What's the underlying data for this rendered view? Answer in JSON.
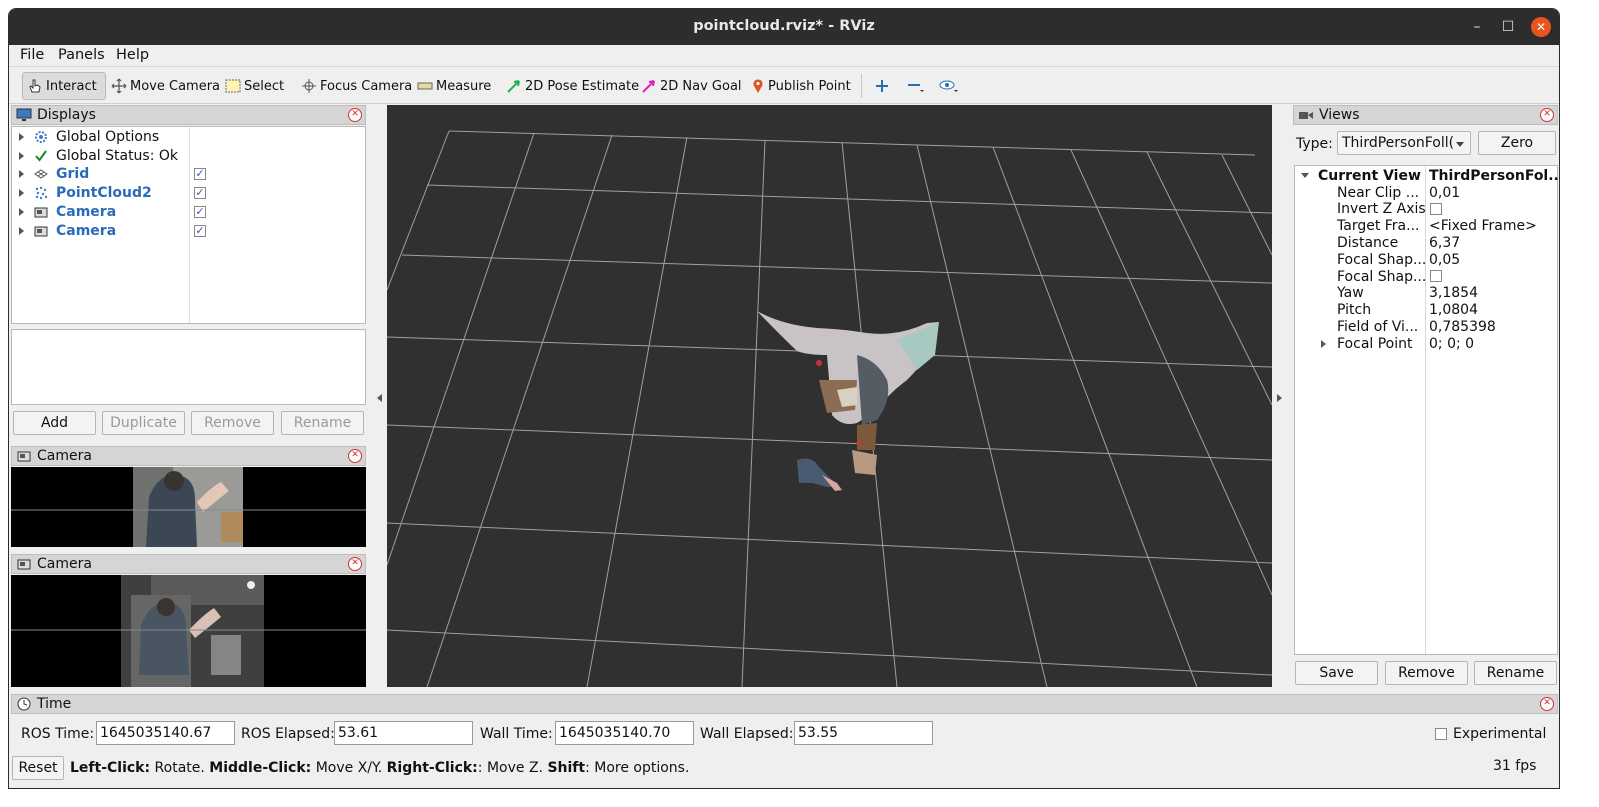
{
  "window": {
    "title": "pointcloud.rviz* - RViz"
  },
  "menu": {
    "file": "File",
    "panels": "Panels",
    "help": "Help"
  },
  "toolbar": {
    "interact": "Interact",
    "move_camera": "Move Camera",
    "select": "Select",
    "focus_camera": "Focus Camera",
    "measure": "Measure",
    "pose_estimate": "2D Pose Estimate",
    "nav_goal": "2D Nav Goal",
    "publish_point": "Publish Point"
  },
  "displays": {
    "title": "Displays",
    "items": [
      {
        "label": "Global Options",
        "icon": "gear-icon",
        "checked": null
      },
      {
        "label": "Global Status: Ok",
        "icon": "checkmark-icon",
        "checked": null
      },
      {
        "label": "Grid",
        "icon": "grid-icon",
        "checked": true
      },
      {
        "label": "PointCloud2",
        "icon": "pointcloud-icon",
        "checked": true
      },
      {
        "label": "Camera",
        "icon": "camera-icon",
        "checked": true
      },
      {
        "label": "Camera",
        "icon": "camera-icon",
        "checked": true
      }
    ],
    "buttons": {
      "add": "Add",
      "duplicate": "Duplicate",
      "remove": "Remove",
      "rename": "Rename"
    }
  },
  "camera_panels": [
    {
      "title": "Camera"
    },
    {
      "title": "Camera"
    }
  ],
  "views": {
    "title": "Views",
    "type_label": "Type:",
    "type_value": "ThirdPersonFoll(",
    "zero": "Zero",
    "header_name": "Current View",
    "header_value": "ThirdPersonFol...",
    "props": [
      {
        "name": "Near Clip ...",
        "value": "0,01"
      },
      {
        "name": "Invert Z Axis",
        "value": ""
      },
      {
        "name": "Target Fra...",
        "value": "<Fixed Frame>"
      },
      {
        "name": "Distance",
        "value": "6,37"
      },
      {
        "name": "Focal Shap...",
        "value": "0,05"
      },
      {
        "name": "Focal Shap...",
        "value": ""
      },
      {
        "name": "Yaw",
        "value": "3,1854"
      },
      {
        "name": "Pitch",
        "value": "1,0804"
      },
      {
        "name": "Field of Vi...",
        "value": "0,785398"
      },
      {
        "name": "Focal Point",
        "value": "0; 0; 0"
      }
    ],
    "buttons": {
      "save": "Save",
      "remove": "Remove",
      "rename": "Rename"
    }
  },
  "time": {
    "title": "Time",
    "ros_time_label": "ROS Time:",
    "ros_time": "1645035140.67",
    "ros_elapsed_label": "ROS Elapsed:",
    "ros_elapsed": "53.61",
    "wall_time_label": "Wall Time:",
    "wall_time": "1645035140.70",
    "wall_elapsed_label": "Wall Elapsed:",
    "wall_elapsed": "53.55",
    "experimental": "Experimental"
  },
  "status": {
    "reset": "Reset",
    "left_click": "Left-Click:",
    "left_click_desc": " Rotate. ",
    "middle_click": "Middle-Click:",
    "middle_click_desc": " Move X/Y. ",
    "right_click": "Right-Click:",
    "right_click_desc": ": Move Z. ",
    "shift": "Shift",
    "shift_desc": ": More options.",
    "fps": "31 fps"
  }
}
